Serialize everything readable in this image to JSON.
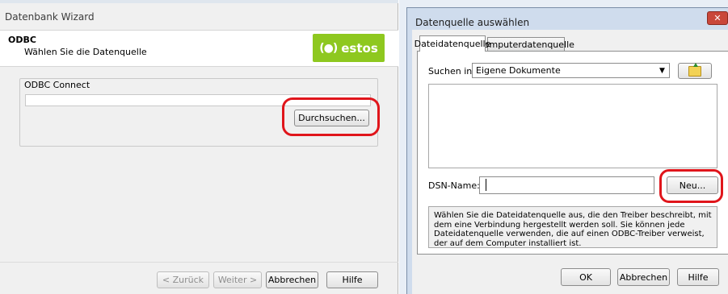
{
  "left_dialog": {
    "title": "Datenbank Wizard",
    "header_title": "ODBC",
    "header_subtitle": "Wählen Sie die Datenquelle",
    "logo_text": "estos",
    "logo_mark": "(●)",
    "group_label": "ODBC Connect",
    "connect_value": "",
    "browse_label": "Durchsuchen...",
    "back_label": "< Zurück",
    "next_label": "Weiter >",
    "cancel_label": "Abbrechen",
    "help_label": "Hilfe",
    "brand_color": "#8ec81f",
    "highlight_color": "#e0151b"
  },
  "right_dialog": {
    "title": "Datenquelle auswählen",
    "close_glyph": "✕",
    "tabs": [
      {
        "label": "Dateidatenquelle",
        "active": true
      },
      {
        "label": "Computerdatenquelle",
        "active": false
      }
    ],
    "lookin_label": "Suchen in:",
    "lookin_value": "Eigene Dokumente",
    "lookin_arrow": "▼",
    "folder_up_icon": "folder-up-icon",
    "dsn_label": "DSN-Name:",
    "dsn_value": "",
    "new_label": "Neu...",
    "info_text": "Wählen Sie die Dateidatenquelle aus, die den Treiber beschreibt, mit dem eine Verbindung hergestellt werden soll. Sie können jede Dateidatenquelle verwenden, die auf einen ODBC-Treiber verweist, der auf dem Computer installiert ist.",
    "ok_label": "OK",
    "cancel_label": "Abbrechen",
    "help_label": "Hilfe"
  }
}
